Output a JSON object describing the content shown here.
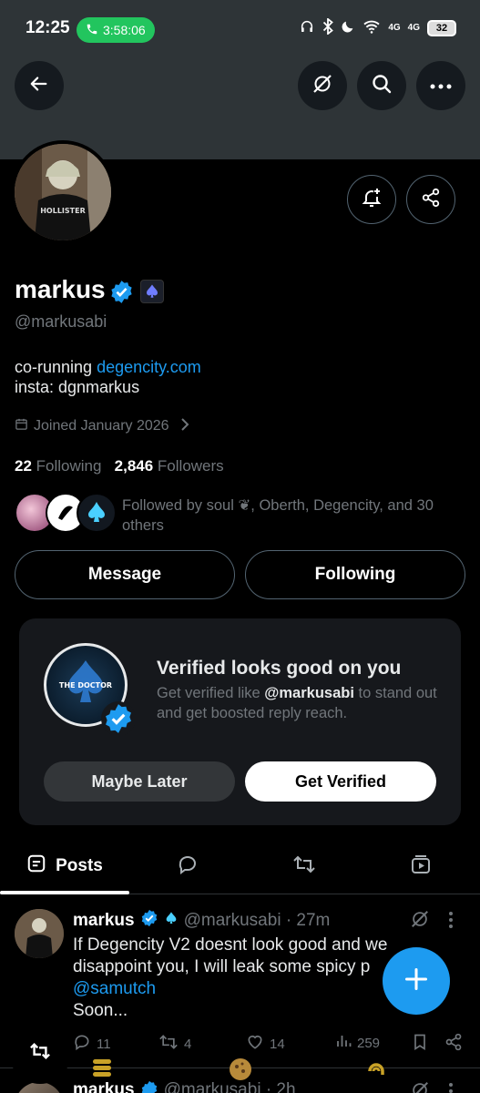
{
  "status_bar": {
    "time": "12:25",
    "call_timer": "3:58:06",
    "network_1": "4G",
    "network_2": "4G",
    "battery": "32"
  },
  "profile": {
    "display_name": "markus",
    "handle": "@markusabi",
    "bio_prefix": "co-running ",
    "bio_link": "degencity.com",
    "bio_line2": "insta: dgnmarkus",
    "joined": "Joined January 2026",
    "following_count": "22",
    "following_label": "Following",
    "followers_count": "2,846",
    "followers_label": "Followers",
    "followed_by": "Followed by soul ❦, Oberth, Degencity, and 30 others",
    "message_label": "Message",
    "following_button_label": "Following"
  },
  "verify_card": {
    "logo_text": "THE DOCTOR",
    "title": "Verified looks good on you",
    "desc_prefix": "Get verified like ",
    "desc_handle": "@markusabi",
    "desc_suffix": " to stand out and get boosted reply reach.",
    "maybe_later": "Maybe Later",
    "get_verified": "Get Verified"
  },
  "tabs": {
    "posts": "Posts"
  },
  "tweet": {
    "name": "markus",
    "handle_time": "@markusabi · 27m",
    "text": "If Degencity V2 doesnt look good and we disappoint you, I will leak some spicy p",
    "mention": "@samutch",
    "text_end": "Soon...",
    "replies": "11",
    "reposts": "4",
    "likes": "14",
    "views": "259"
  },
  "next_tweet": {
    "name": "markus",
    "handle_time": "@markusabi · 2h"
  },
  "colors": {
    "accent": "#1d9bf0",
    "background": "#000000",
    "muted": "#71767b",
    "banner": "#2e3437"
  }
}
